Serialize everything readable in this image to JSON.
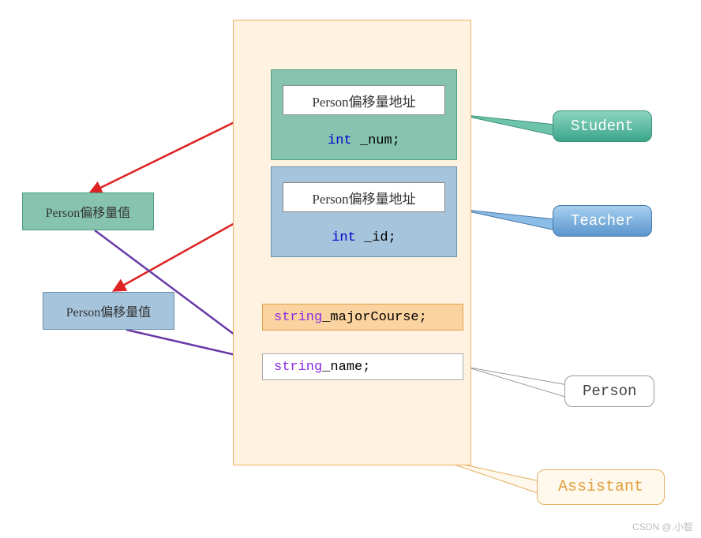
{
  "diagram": {
    "container_label": "Assistant",
    "student_block": {
      "addr_label": "Person偏移量地址",
      "member_kw": "int",
      "member_name": " _num;"
    },
    "teacher_block": {
      "addr_label": "Person偏移量地址",
      "member_kw": "int",
      "member_name": " _id;"
    },
    "major_course_row": {
      "kw": "string",
      "name": " _majorCourse;"
    },
    "name_row": {
      "kw": "string",
      "name": " _name;"
    },
    "offset_green": "Person偏移量值",
    "offset_blue": "Person偏移量值",
    "callouts": {
      "student": "Student",
      "teacher": "Teacher",
      "person": "Person",
      "assistant": "Assistant"
    }
  },
  "watermark": "CSDN @.小智"
}
